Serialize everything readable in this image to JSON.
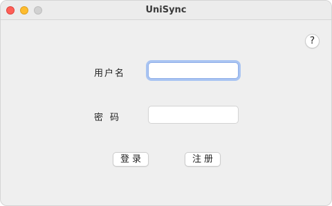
{
  "window": {
    "title": "UniSync"
  },
  "help": {
    "label": "?"
  },
  "form": {
    "username_label": "用户名",
    "username_value": "",
    "password_label": "密码",
    "password_value": ""
  },
  "actions": {
    "login_label": "登录",
    "register_label": "注册"
  },
  "colors": {
    "close": "#fe5f57",
    "minimize": "#febc2e",
    "zoom": "#d1d1d1",
    "focus_ring": "#a9c4f2"
  }
}
